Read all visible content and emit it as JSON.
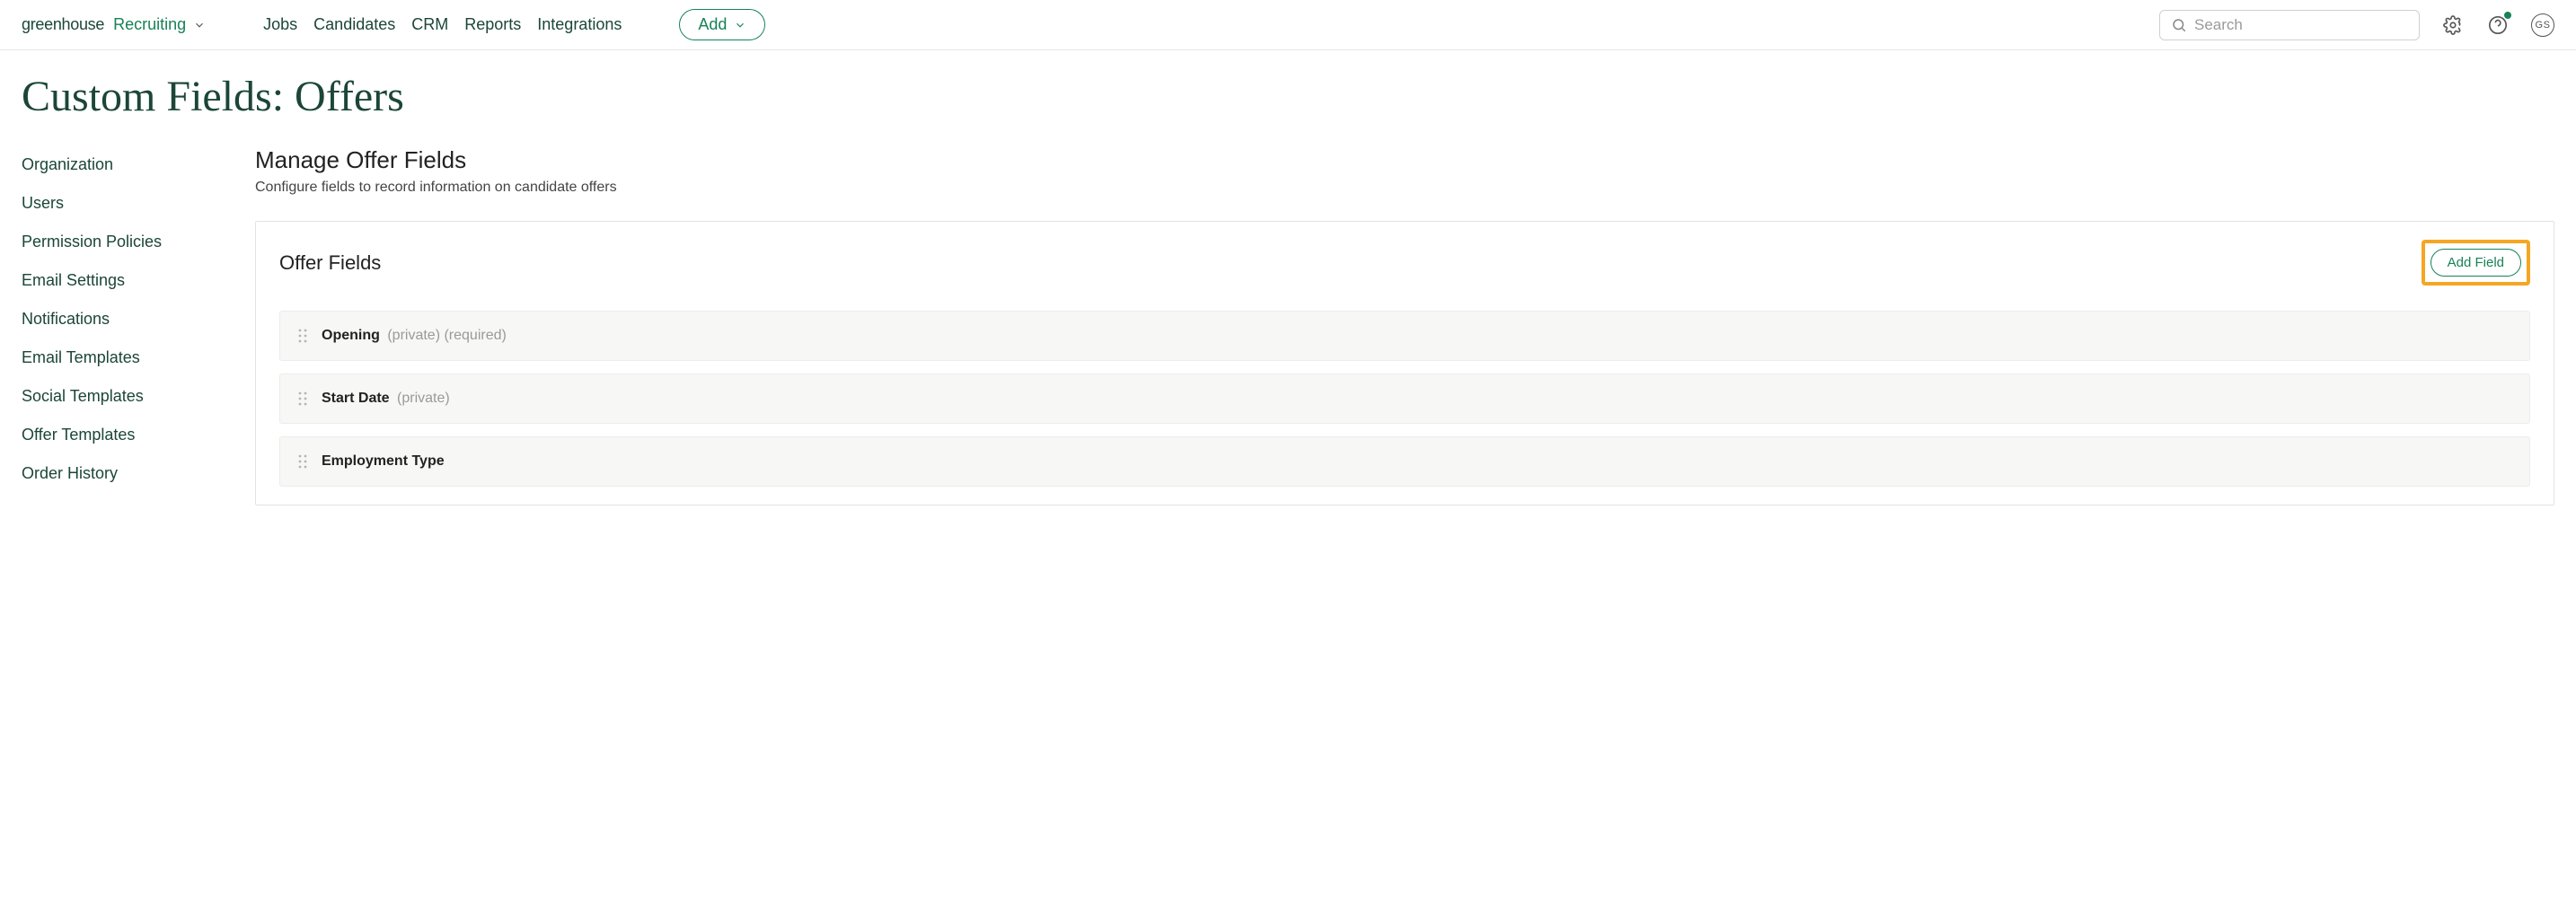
{
  "brand": {
    "part1": "greenhouse",
    "part2": "Recruiting"
  },
  "nav": {
    "jobs": "Jobs",
    "candidates": "Candidates",
    "crm": "CRM",
    "reports": "Reports",
    "integrations": "Integrations",
    "add": "Add"
  },
  "search": {
    "placeholder": "Search"
  },
  "avatar": "GS",
  "page_title": "Custom Fields: Offers",
  "sidebar": {
    "items": [
      "Organization",
      "Users",
      "Permission Policies",
      "Email Settings",
      "Notifications",
      "Email Templates",
      "Social Templates",
      "Offer Templates",
      "Order History"
    ]
  },
  "main": {
    "title": "Manage Offer Fields",
    "subtitle": "Configure fields to record information on candidate offers",
    "panel_title": "Offer Fields",
    "add_field": "Add Field",
    "fields": [
      {
        "name": "Opening",
        "meta": "(private) (required)"
      },
      {
        "name": "Start Date",
        "meta": "(private)"
      },
      {
        "name": "Employment Type",
        "meta": ""
      }
    ]
  }
}
